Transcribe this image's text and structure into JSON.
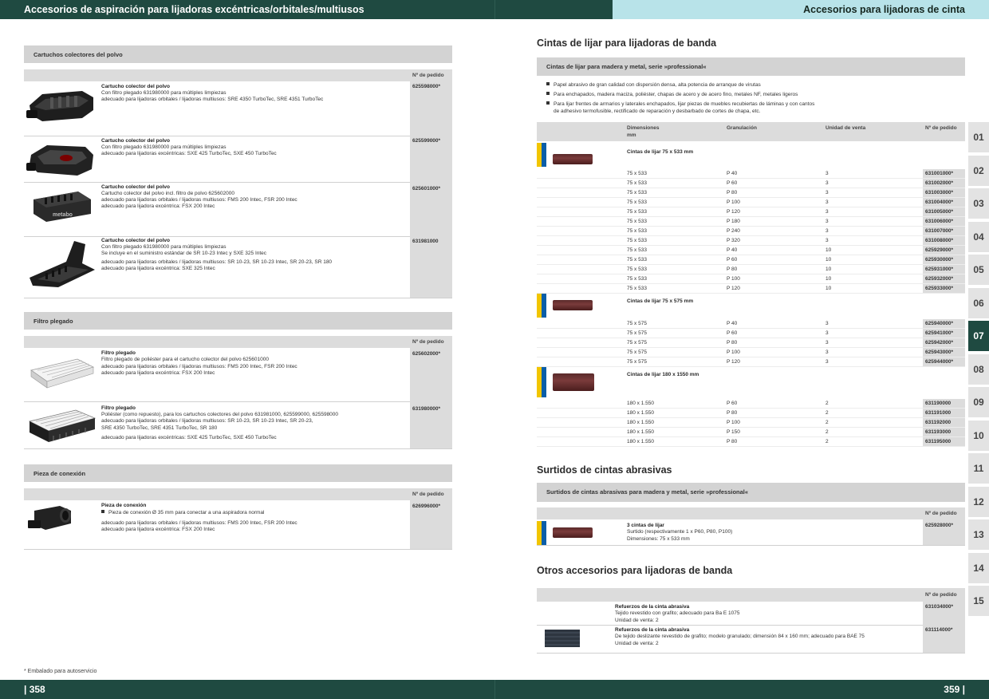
{
  "header": {
    "left_title": "Accesorios de aspiración para lijadoras excéntricas/orbitales/multiusos",
    "right_title": "Accesorios para lijadoras de cinta"
  },
  "footer": {
    "left_page": "| 358",
    "right_page": "359 |",
    "footnote": "* Embalado para autoservicio"
  },
  "order_header": "Nº de pedido",
  "left": {
    "section1": {
      "title": "Cartuchos colectores del polvo",
      "items": [
        {
          "name": "Cartucho colector del polvo",
          "lines": [
            "Con filtro plegado 631980000 para múltiples limpiezas",
            "adecuado para lijadoras orbitales / lijadoras multiusos: SRE 4350 TurboTec, SRE 4351 TurboTec"
          ],
          "order": "625598000*"
        },
        {
          "name": "Cartucho colector del polvo",
          "lines": [
            "Con filtro plegado 631980000 para múltiples limpiezas",
            "adecuado para lijadoras excéntricas: SXE 425 TurboTec, SXE 450 TurboTec"
          ],
          "order": "625599000*"
        },
        {
          "name": "Cartucho colector del polvo",
          "lines": [
            "Cartucho colector del polvo incl. filtro de polvo 625602000",
            "adecuado para lijadoras orbitales / lijadoras multiusos: FMS 200 Intec, FSR 200 Intec",
            "adecuado para lijadora excéntrica: FSX 200 Intec"
          ],
          "order": "625601000*"
        },
        {
          "name": "Cartucho colector del polvo",
          "lines": [
            "Con filtro plegado 631980000 para múltiples limpiezas",
            "Se incluye en el suministro estándar de SR 10-23 Intec y SXE 325 Intec",
            "adecuado para lijadoras orbitales / lijadoras multiusos: SR 10-23, SR 10-23 Intec, SR 20-23, SR 180",
            "adecuado para lijadora excéntrica: SXE 325 Intec"
          ],
          "order": "631981000"
        }
      ]
    },
    "section2": {
      "title": "Filtro plegado",
      "items": [
        {
          "name": "Filtro plegado",
          "lines": [
            "Filtro plegado de poliéster para el cartucho colector del polvo 625601000",
            "adecuado para lijadoras orbitales / lijadoras multiusos: FMS 200 Intec, FSR 200 Intec",
            "adecuado para lijadora excéntrica: FSX 200 Intec"
          ],
          "order": "625602000*"
        },
        {
          "name": "Filtro plegado",
          "lines": [
            "Poliéster (como repuesto), para los cartuchos colectores del polvo 631981000, 625599000, 625598000",
            "adecuado para lijadoras orbitales / lijadoras multiusos: SR 10-23, SR 10-23 Intec, SR 20-23,",
            "SRE 4350 TurboTec, SRE 4351 TurboTec, SR 180",
            "adecuado para lijadoras excéntricas: SXE 425 TurboTec, SXE 450 TurboTec"
          ],
          "order": "631980000*"
        }
      ]
    },
    "section3": {
      "title": "Pieza de conexión",
      "items": [
        {
          "name": "Pieza de conexión",
          "lines": [
            "Pieza de conexión Ø 35 mm para conectar a una aspiradora normal",
            "adecuado para lijadoras orbitales / lijadoras multiusos: FMS 200 Intec, FSR 200 Intec",
            "adecuado para lijadora excéntrica: FSX 200 Intec"
          ],
          "order": "626996000*"
        }
      ]
    }
  },
  "right": {
    "cintas": {
      "heading": "Cintas de lijar para lijadoras de banda",
      "subbar": "Cintas de lijar para madera y metal, serie »professional«",
      "bullets": [
        "Papel abrasivo de gran calidad con dispersión densa, alta potencia de arranque de virutas",
        "Para enchapados, madera maciza, poliéster, chapas de acero y de acero fino, metales NF, metales ligeros",
        "Para lijar frentes de armarios y laterales enchapados, lijar piezas de muebles recubiertas de láminas y con cantos",
        "de adhesivo termofusible, rectificado de reparación y desbarbado de cortes de chapa, etc."
      ],
      "columns": {
        "dim": "Dimensiones",
        "dim_unit": "mm",
        "grit": "Granulación",
        "unit": "Unidad de venta",
        "order": "Nº de pedido"
      },
      "groups": [
        {
          "title": "Cintas de lijar 75 x 533 mm",
          "rows": [
            [
              "75 x 533",
              "P 40",
              "3",
              "631001000*"
            ],
            [
              "75 x 533",
              "P 60",
              "3",
              "631002000*"
            ],
            [
              "75 x 533",
              "P 80",
              "3",
              "631003000*"
            ],
            [
              "75 x 533",
              "P 100",
              "3",
              "631004000*"
            ],
            [
              "75 x 533",
              "P 120",
              "3",
              "631005000*"
            ],
            [
              "75 x 533",
              "P 180",
              "3",
              "631006000*"
            ],
            [
              "75 x 533",
              "P 240",
              "3",
              "631007000*"
            ],
            [
              "75 x 533",
              "P 320",
              "3",
              "631008000*"
            ],
            [
              "75 x 533",
              "P 40",
              "10",
              "625929000*"
            ],
            [
              "75 x 533",
              "P 60",
              "10",
              "625930000*"
            ],
            [
              "75 x 533",
              "P 80",
              "10",
              "625931000*"
            ],
            [
              "75 x 533",
              "P 100",
              "10",
              "625932000*"
            ],
            [
              "75 x 533",
              "P 120",
              "10",
              "625933000*"
            ]
          ]
        },
        {
          "title": "Cintas de lijar 75 x 575 mm",
          "rows": [
            [
              "75 x 575",
              "P 40",
              "3",
              "625940000*"
            ],
            [
              "75 x 575",
              "P 60",
              "3",
              "625941000*"
            ],
            [
              "75 x 575",
              "P 80",
              "3",
              "625942000*"
            ],
            [
              "75 x 575",
              "P 100",
              "3",
              "625943000*"
            ],
            [
              "75 x 575",
              "P 120",
              "3",
              "625944000*"
            ]
          ]
        },
        {
          "title": "Cintas de lijar 180 x 1550 mm",
          "rows": [
            [
              "180 x 1.550",
              "P 60",
              "2",
              "631190000"
            ],
            [
              "180 x 1.550",
              "P 80",
              "2",
              "631191000"
            ],
            [
              "180 x 1.550",
              "P 100",
              "2",
              "631192000"
            ],
            [
              "180 x 1.550",
              "P 150",
              "2",
              "631193000"
            ],
            [
              "180 x 1.550",
              "P 80",
              "2",
              "631195000"
            ]
          ]
        }
      ]
    },
    "surtidos": {
      "heading": "Surtidos de cintas abrasivas",
      "subbar": "Surtidos de cintas abrasivas para madera y metal, serie »professional«",
      "item": {
        "name": "3 cintas de lijar",
        "lines": [
          "Surtido (respectivamente 1 x P60, P80, P100)",
          "Dimensiones: 75 x 533 mm"
        ],
        "order": "625928000*"
      }
    },
    "otros": {
      "heading": "Otros accesorios para lijadoras de banda",
      "items": [
        {
          "name": "Refuerzos de la cinta abrasiva",
          "lines": [
            "Tejido revestido con grafito; adecuado para Ba E 1075",
            "Unidad de venta: 2"
          ],
          "order": "631034000*"
        },
        {
          "name": "Refuerzos de la cinta abrasiva",
          "lines": [
            "De tejido deslizante revestido de grafito; modelo granulado; dimensión 84 x 160 mm; adecuado para BAE 75",
            "Unidad de venta: 2"
          ],
          "order": "631114000*"
        }
      ]
    }
  },
  "side_tabs": [
    "01",
    "02",
    "03",
    "04",
    "05",
    "06",
    "07",
    "08",
    "09",
    "10",
    "11",
    "12",
    "13",
    "14",
    "15"
  ],
  "active_tab": "07",
  "colors": {
    "brand_dark": "#1f4a41",
    "accent_light": "#b8e3e9",
    "strip_blue": "#0a5ea8",
    "strip_yellow": "#f2c500"
  }
}
